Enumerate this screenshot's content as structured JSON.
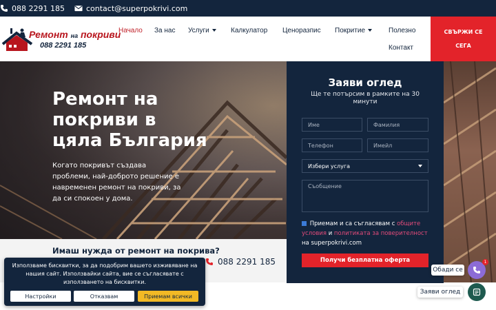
{
  "topbar": {
    "phone": "088 2291 185",
    "email": "contact@superpokrivi.com"
  },
  "logo": {
    "brand_main": "Ремонт",
    "brand_small": "на",
    "brand_end": "покриви",
    "phone": "088 2291 185"
  },
  "nav": {
    "home": "Начало",
    "about": "За нас",
    "services": "Услуги",
    "calculator": "Калкулатор",
    "prices": "Ценоразпис",
    "roofing": "Покритие",
    "useful": "Полезно",
    "contact": "Контакт",
    "cta": "СВЪРЖИ СЕ СЕГА"
  },
  "hero": {
    "title": "Ремонт на покриви в цяла България",
    "text": "Когато покривът създава проблеми, най-доброто решение е навременен ремонт на покриви, за да си спокоен у дома."
  },
  "band": {
    "question": "Имаш нужда от ремонт на покрива?",
    "phone": "088 2291 185"
  },
  "form": {
    "title": "Заяви оглед",
    "subtitle": "Ще те потърсим в рамките на 30 минути",
    "first_name": "Име",
    "last_name": "Фамилия",
    "phone": "Телефон",
    "email": "Имейл",
    "service": "Избери услуга",
    "message": "Съобщение",
    "consent_a": "Приемам и са съгласявам с",
    "terms": "общите условия",
    "consent_and": "и",
    "privacy": "политиката за поверителност",
    "consent_site": "на superpokrivi.com",
    "submit": "Получи безплатна оферта"
  },
  "cookie": {
    "text": "Използваме бисквитки, за да подобрим вашето изживяване на нашия сайт. Използвайки сайта, вие се съгласявате с използването на бисквитки.",
    "settings": "Настройки",
    "decline": "Отказвам",
    "accept": "Приемам всички"
  },
  "floating": {
    "call_label": "Обади се",
    "badge": "1",
    "request_label": "Заяви оглед"
  },
  "colors": {
    "navy": "#13253d",
    "red": "#e3232a",
    "accent_link": "#e34b7a",
    "call_button": "#8c6bd6",
    "form_button": "#1e5a4f",
    "cookie_accept": "#f2b925"
  },
  "icons": [
    "phone-icon",
    "email-icon",
    "chevron-down-icon",
    "chat-icon"
  ]
}
